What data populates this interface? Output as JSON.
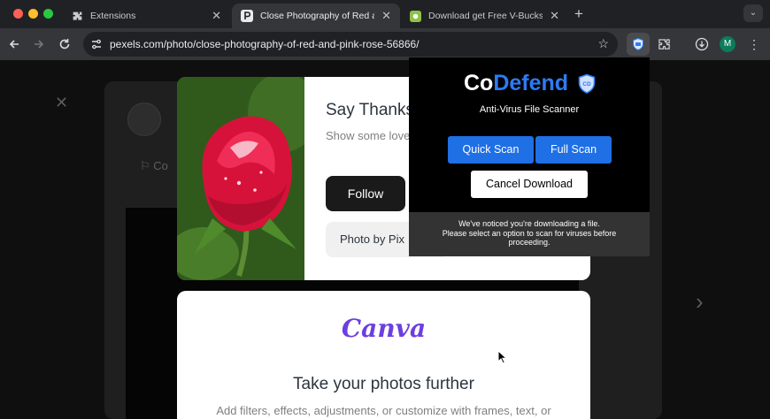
{
  "browser": {
    "tabs": [
      {
        "title": "Extensions",
        "favicon": "puzzle-icon",
        "active": false
      },
      {
        "title": "Close Photography of Red and Pink Rose",
        "favicon": "pexels-icon",
        "active": true
      },
      {
        "title": "Download get Free V-Bucks and",
        "favicon": "android-icon",
        "active": false
      }
    ],
    "url": "pexels.com/photo/close-photography-of-red-and-pink-rose-56866/",
    "profile_initial": "M"
  },
  "page": {
    "thanks_modal": {
      "title": "Say Thanks",
      "body": "Show some love small donation.",
      "follow_label": "Follow",
      "photo_by_label": "Photo by Pix"
    },
    "canva_card": {
      "logo": "Canva",
      "title": "Take your photos further",
      "subtitle": "Add filters, effects, adjustments, or customize with frames, text, or"
    },
    "collect_label": "Co"
  },
  "extension_popup": {
    "brand_co": "Co",
    "brand_defend": "Defend",
    "subtitle": "Anti-Virus File Scanner",
    "quick_scan_label": "Quick Scan",
    "full_scan_label": "Full Scan",
    "cancel_label": "Cancel Download",
    "notice_line1": "We've noticed you're downloading a file.",
    "notice_line2": "Please select an option to scan for viruses before",
    "notice_line3": "proceeding.",
    "shield_text": "CD"
  },
  "colors": {
    "accent_blue": "#1f6fe5",
    "brand_blue": "#2d7bf4",
    "canva_purple": "#6c3fe0"
  }
}
